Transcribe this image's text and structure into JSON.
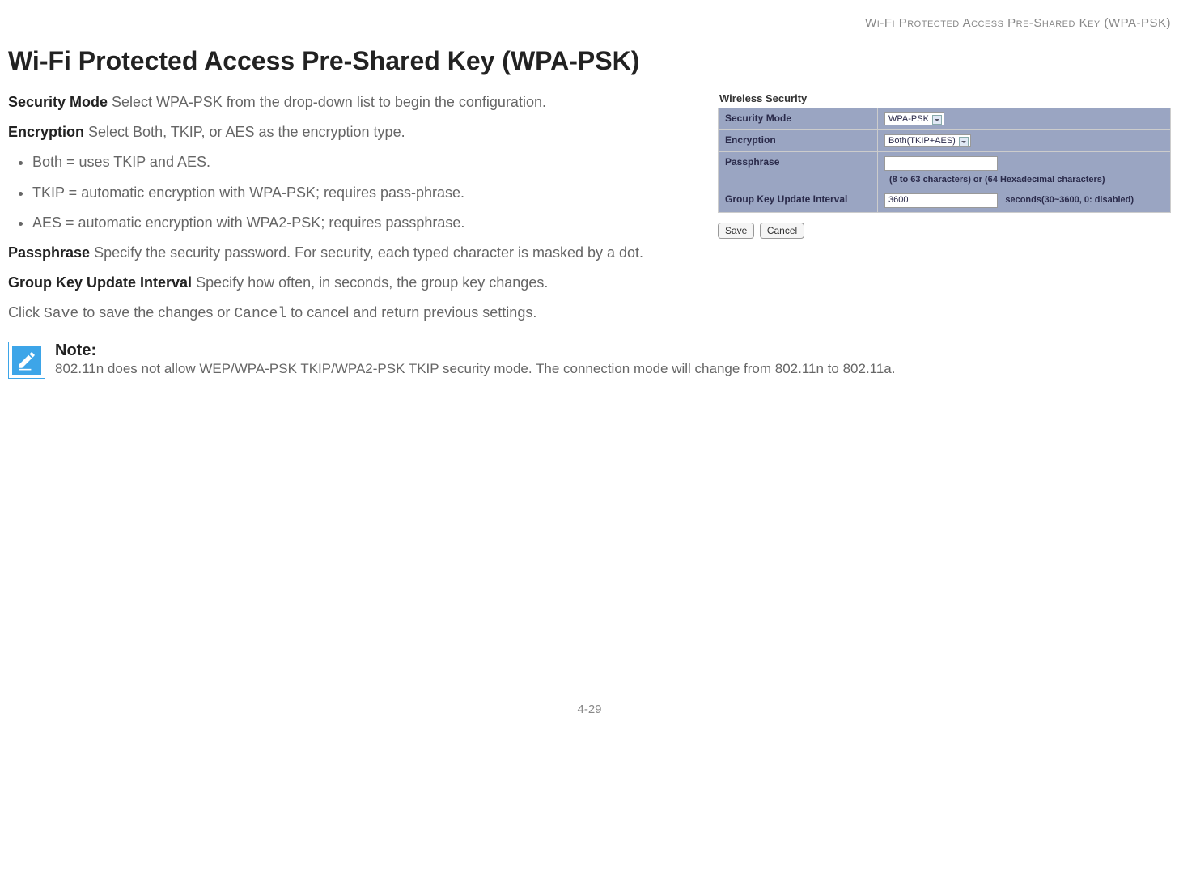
{
  "header_right": "Wi-Fi Protected Access Pre-Shared Key (WPA-PSK)",
  "title": "Wi-Fi Protected Access Pre-Shared Key (WPA-PSK)",
  "intro": {
    "security_mode_label": "Security Mode",
    "security_mode_text": "  Select WPA-PSK from the drop-down list to begin the configuration.",
    "encryption_label": "Encryption",
    "encryption_text": "  Select Both, TKIP, or AES as the encryption type.",
    "bullets": [
      "Both = uses TKIP and AES.",
      "TKIP = automatic encryption with WPA-PSK; requires pass-phrase.",
      "AES = automatic encryption with WPA2-PSK; requires passphrase."
    ],
    "passphrase_label": "Passphrase",
    "passphrase_text": "  Specify the security password. For security, each typed character is masked by a dot.",
    "group_key_label": "Group Key Update Interval",
    "group_key_text": "  Specify how often, in seconds, the group key changes.",
    "click_prefix": "Click ",
    "save_code": "Save",
    "click_mid": " to save the changes or ",
    "cancel_code": "Cancel",
    "click_suffix": " to cancel and return previous settings."
  },
  "panel": {
    "title": "Wireless Security",
    "rows": {
      "security_mode": {
        "label": "Security Mode",
        "value": "WPA-PSK"
      },
      "encryption": {
        "label": "Encryption",
        "value": "Both(TKIP+AES)"
      },
      "passphrase": {
        "label": "Passphrase",
        "value": "",
        "hint": "(8 to 63 characters) or (64 Hexadecimal characters)"
      },
      "group_key": {
        "label": "Group Key Update Interval",
        "value": "3600",
        "hint": "seconds(30~3600, 0: disabled)"
      }
    },
    "buttons": {
      "save": "Save",
      "cancel": "Cancel"
    }
  },
  "note": {
    "label": "Note:",
    "body": "802.11n does not allow WEP/WPA-PSK TKIP/WPA2-PSK TKIP security mode. The connection mode will change from 802.11n to 802.11a."
  },
  "page_number": "4-29"
}
